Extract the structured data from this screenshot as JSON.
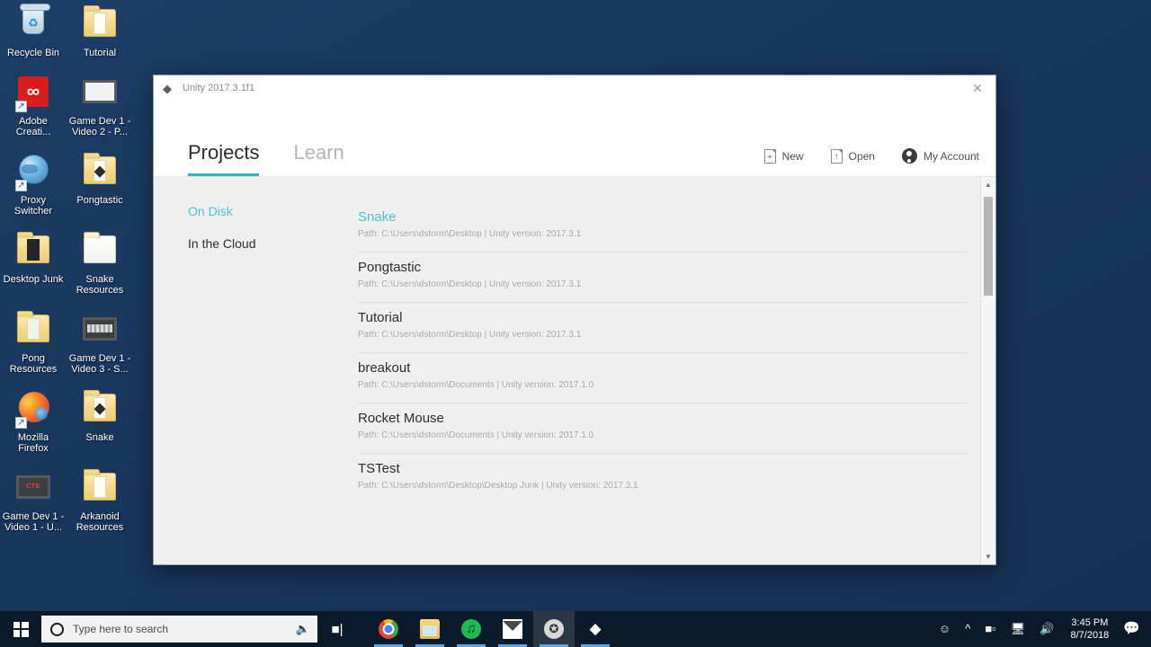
{
  "desktop": {
    "background_color": "#1b3a61",
    "icons": [
      {
        "label": "Recycle Bin",
        "kind": "recycle-bin",
        "shortcut": false
      },
      {
        "label": "Tutorial",
        "kind": "folder-unity",
        "shortcut": false
      },
      {
        "label": "Adobe Creati...",
        "kind": "adobe-cc",
        "shortcut": true
      },
      {
        "label": "Game Dev 1 - Video 2 - P...",
        "kind": "video-file",
        "shortcut": false
      },
      {
        "label": "Proxy Switcher",
        "kind": "globe",
        "shortcut": true
      },
      {
        "label": "Pongtastic",
        "kind": "folder-unity",
        "shortcut": false
      },
      {
        "label": "Desktop Junk",
        "kind": "folder-dark",
        "shortcut": false
      },
      {
        "label": "Snake Resources",
        "kind": "folder-plain",
        "shortcut": false
      },
      {
        "label": "Pong Resources",
        "kind": "folder-docs",
        "shortcut": false
      },
      {
        "label": "Game Dev 1 - Video 3 - S...",
        "kind": "video-file-strip",
        "shortcut": false
      },
      {
        "label": "Mozilla Firefox",
        "kind": "firefox",
        "shortcut": true
      },
      {
        "label": "Snake",
        "kind": "folder-unity",
        "shortcut": false
      },
      {
        "label": "Game Dev 1 - Video 1 - U...",
        "kind": "video-file-cte",
        "shortcut": false
      },
      {
        "label": "Arkanoid Resources",
        "kind": "folder-plain-yellow",
        "shortcut": false
      }
    ]
  },
  "unity_window": {
    "title": "Unity 2017.3.1f1",
    "logo_icon": "unity-logo-icon",
    "close_icon": "close-icon",
    "tabs": [
      {
        "label": "Projects",
        "active": true
      },
      {
        "label": "Learn",
        "active": false
      }
    ],
    "accent_color": "#2bb3c0",
    "actions": [
      {
        "label": "New",
        "icon": "new-document-icon"
      },
      {
        "label": "Open",
        "icon": "open-folder-icon"
      },
      {
        "label": "My Account",
        "icon": "account-avatar-icon"
      }
    ],
    "sidebar": [
      {
        "label": "On Disk",
        "active": true
      },
      {
        "label": "In the Cloud",
        "active": false
      }
    ],
    "projects": [
      {
        "name": "Snake",
        "path": "Path: C:\\Users\\dstorm\\Desktop | Unity version: 2017.3.1",
        "selected": true
      },
      {
        "name": "Pongtastic",
        "path": "Path: C:\\Users\\dstorm\\Desktop | Unity version: 2017.3.1",
        "selected": false
      },
      {
        "name": "Tutorial",
        "path": "Path: C:\\Users\\dstorm\\Desktop | Unity version: 2017.3.1",
        "selected": false
      },
      {
        "name": "breakout",
        "path": "Path: C:\\Users\\dstorm\\Documents | Unity version: 2017.1.0",
        "selected": false
      },
      {
        "name": "Rocket Mouse",
        "path": "Path: C:\\Users\\dstorm\\Documents | Unity version: 2017.1.0",
        "selected": false
      },
      {
        "name": "TSTest",
        "path": "Path: C:\\Users\\dstorm\\Desktop\\Desktop Junk | Unity version: 2017.3.1",
        "selected": false
      }
    ],
    "scrollbar": {
      "up_icon": "chevron-up-icon",
      "down_icon": "chevron-down-icon"
    }
  },
  "taskbar": {
    "start_icon": "windows-start-icon",
    "search": {
      "placeholder": "Type here to search",
      "value": "Type here to search",
      "search_icon": "search-circle-icon",
      "mic_icon": "microphone-icon"
    },
    "task_view_icon": "task-view-icon",
    "apps": [
      {
        "name": "Google Chrome",
        "icon": "chrome-icon",
        "running": true,
        "active": false
      },
      {
        "name": "File Explorer",
        "icon": "file-explorer-icon",
        "running": true,
        "active": false
      },
      {
        "name": "Spotify",
        "icon": "spotify-icon",
        "running": true,
        "active": false
      },
      {
        "name": "Mail",
        "icon": "mail-icon",
        "running": true,
        "active": false
      },
      {
        "name": "Screen Recorder",
        "icon": "recorder-icon",
        "running": true,
        "active": true
      },
      {
        "name": "Unity",
        "icon": "unity-icon",
        "running": true,
        "active": false
      }
    ],
    "tray": [
      {
        "icon": "people-icon"
      },
      {
        "icon": "chevron-up-icon"
      },
      {
        "icon": "battery-icon"
      },
      {
        "icon": "network-icon"
      },
      {
        "icon": "volume-icon"
      }
    ],
    "clock": {
      "time": "3:45 PM",
      "date": "8/7/2018"
    },
    "notifications_icon": "notifications-icon"
  }
}
